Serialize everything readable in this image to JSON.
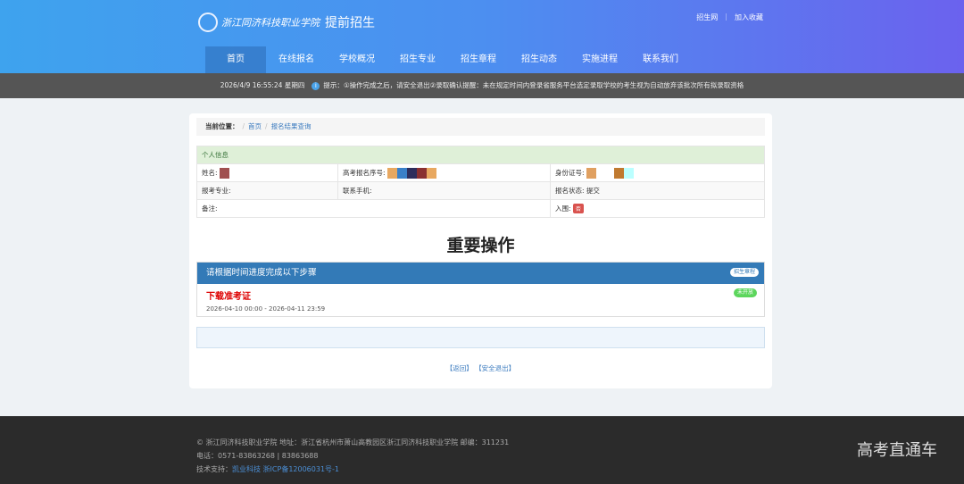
{
  "header": {
    "school_calligraphy": "浙江同济科技职业学院",
    "seal_text": "校徽",
    "subtitle": "提前招生",
    "links": [
      "招生网",
      "加入收藏"
    ]
  },
  "nav": [
    "首页",
    "在线报名",
    "学校概况",
    "招生专业",
    "招生章程",
    "招生动态",
    "实施进程",
    "联系我们"
  ],
  "notice": {
    "datetime": "2026/4/9 16:55:24 星期四",
    "text": "提示：①操作完成之后，请安全退出②录取确认提醒：未在规定时间内登录省服务平台选定录取学校的考生视为自动放弃该批次所有拟录取资格"
  },
  "breadcrumb": {
    "label": "当前位置：",
    "items": [
      "首页",
      "报名结果查询"
    ]
  },
  "info": {
    "title": "个人信息",
    "name": "姓名:",
    "exam_no": "高考报名序号:",
    "id_no": "身份证号:",
    "major": "报考专业:",
    "phone": "联系手机:",
    "status_label": "报名状态:",
    "status": "提交",
    "remark": "备注:",
    "shortlist_label": "入围:",
    "shortlist": "否"
  },
  "ops": {
    "title": "重要操作",
    "panel_title": "请根据时间进度完成以下步骤",
    "panel_badge": "招生章程",
    "step": "下载准考证",
    "time": "2026-04-10 00:00 - 2026-04-11 23:59",
    "step_badge": "未开放"
  },
  "actions": [
    "【返回】",
    "【安全退出】"
  ],
  "footer": {
    "line1": "© 浙江同济科技职业学院 地址：浙江省杭州市萧山高教园区浙江同济科技职业学院 邮编：311231",
    "line2": "电话：0571-83863268 | 83863688",
    "support_label": "技术支持：",
    "support": "凯业科技",
    "icp": "浙ICP备12006031号-1",
    "watermark": "高考直通车"
  }
}
